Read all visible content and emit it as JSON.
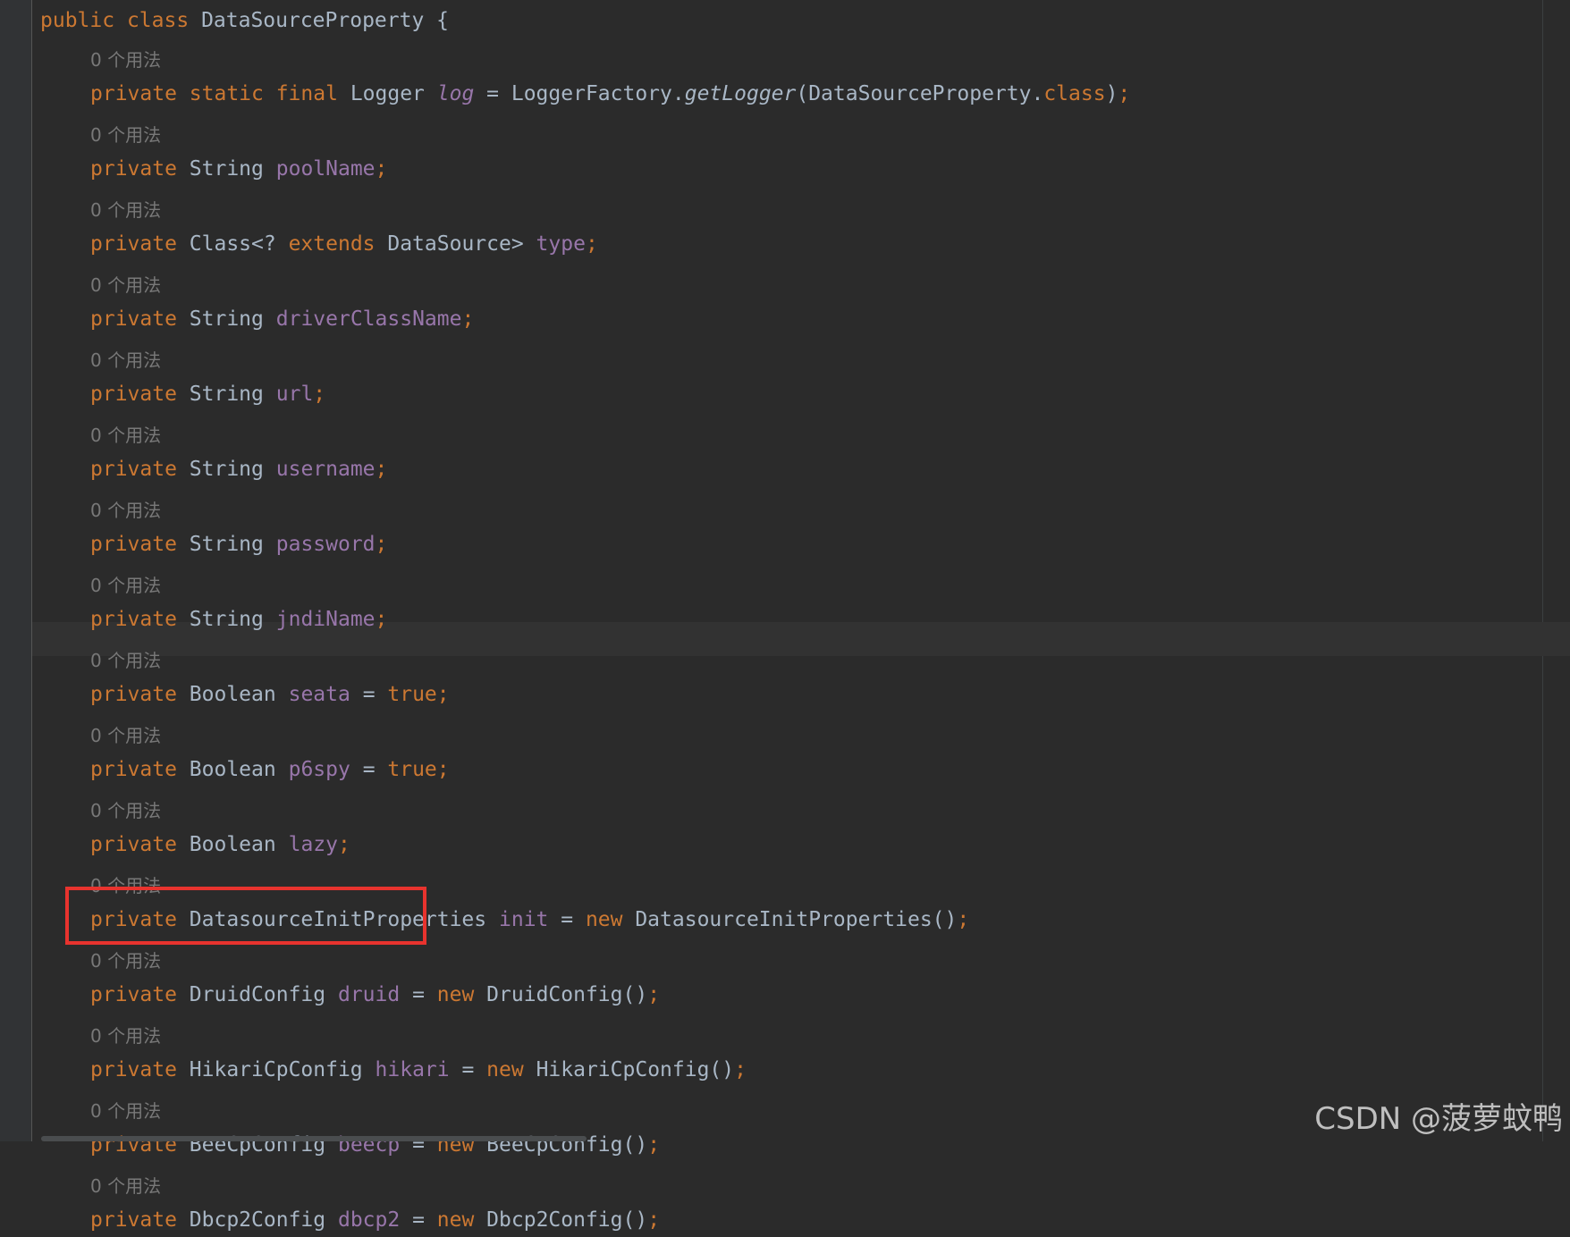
{
  "editor": {
    "language": "Java",
    "usage_hint": "0 个用法",
    "class_decl": {
      "kw_public": "public",
      "kw_class": "class",
      "name": "DataSourceProperty",
      "brace": " {"
    },
    "fields": [
      {
        "modifiers": "private static final",
        "type": "Logger",
        "name": "log",
        "name_style": "static",
        "init_eq": " = ",
        "init_new": "",
        "init_expr": "LoggerFactory.",
        "init_method": "getLogger",
        "init_args": "(DataSourceProperty.",
        "init_args_kw": "class",
        "init_close": ")",
        "semicolon": ";"
      },
      {
        "modifiers": "private",
        "type": "String",
        "name": "poolName",
        "semicolon": ";"
      },
      {
        "modifiers": "private",
        "type": "Class<? ",
        "type_kw": "extends",
        "type_tail": " DataSource>",
        "name": "type",
        "semicolon": ";"
      },
      {
        "modifiers": "private",
        "type": "String",
        "name": "driverClassName",
        "semicolon": ";"
      },
      {
        "modifiers": "private",
        "type": "String",
        "name": "url",
        "semicolon": ";"
      },
      {
        "modifiers": "private",
        "type": "String",
        "name": "username",
        "semicolon": ";"
      },
      {
        "modifiers": "private",
        "type": "String",
        "name": "password",
        "semicolon": ";"
      },
      {
        "modifiers": "private",
        "type": "String",
        "name": "jndiName",
        "semicolon": ";"
      },
      {
        "modifiers": "private",
        "type": "Boolean",
        "name": "seata",
        "init_eq": " = ",
        "init_value": "true",
        "semicolon": ";"
      },
      {
        "modifiers": "private",
        "type": "Boolean",
        "name": "p6spy",
        "init_eq": " = ",
        "init_value": "true",
        "semicolon": ";"
      },
      {
        "modifiers": "private",
        "type": "Boolean",
        "name": "lazy",
        "semicolon": ";"
      },
      {
        "modifiers": "private",
        "type": "DatasourceInitProperties",
        "name": "init",
        "init_eq": " = ",
        "init_new": "new",
        "init_expr": " DatasourceInitProperties()",
        "semicolon": ";"
      },
      {
        "modifiers": "private",
        "type": "DruidConfig",
        "name": "druid",
        "init_eq": " = ",
        "init_new": "new",
        "init_expr": " DruidConfig()",
        "semicolon": ";"
      },
      {
        "modifiers": "private",
        "type": "HikariCpConfig",
        "name": "hikari",
        "init_eq": " = ",
        "init_new": "new",
        "init_expr": " HikariCpConfig()",
        "semicolon": ";"
      },
      {
        "modifiers": "private",
        "type": "BeeCpConfig",
        "name": "beecp",
        "init_eq": " = ",
        "init_new": "new",
        "init_expr": " BeeCpConfig()",
        "semicolon": ";"
      },
      {
        "modifiers": "private",
        "type": "Dbcp2Config",
        "name": "dbcp2",
        "init_eq": " = ",
        "init_new": "new",
        "init_expr": " Dbcp2Config()",
        "semicolon": ";"
      }
    ],
    "highlighted_field": "druid",
    "current_line_field": "seata"
  },
  "colors": {
    "background": "#2b2b2b",
    "keyword": "#cc7832",
    "field": "#9876aa",
    "default_text": "#a9b7c6",
    "hint": "#787878",
    "highlight_box": "#e8332e"
  },
  "watermark": "CSDN @菠萝蚊鸭"
}
